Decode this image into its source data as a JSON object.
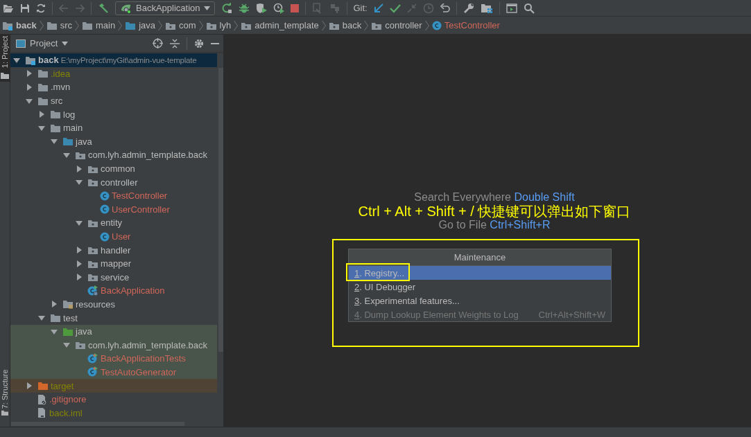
{
  "toolbar": {
    "run_config": "BackApplication",
    "git_label": "Git:"
  },
  "breadcrumbs": [
    {
      "label": "back",
      "kind": "module"
    },
    {
      "label": "src",
      "kind": "folder"
    },
    {
      "label": "main",
      "kind": "folder"
    },
    {
      "label": "java",
      "kind": "source-root"
    },
    {
      "label": "com",
      "kind": "package"
    },
    {
      "label": "lyh",
      "kind": "package"
    },
    {
      "label": "admin_template",
      "kind": "package"
    },
    {
      "label": "back",
      "kind": "package"
    },
    {
      "label": "controller",
      "kind": "package"
    },
    {
      "label": "TestController",
      "kind": "class"
    }
  ],
  "side_tabs": [
    {
      "label": "1: Project",
      "selected": true
    },
    {
      "label": "7: Structure",
      "selected": false
    }
  ],
  "project_panel": {
    "title": "Project",
    "tree": [
      {
        "label": "back",
        "path": "E:\\myProject\\myGit\\admin-vue-template",
        "kind": "module",
        "color": "#bbbbbb",
        "in_test": false,
        "excluded": false,
        "selected": true,
        "expanded": true,
        "children": [
          {
            "label": ".idea",
            "kind": "folder",
            "color": "#848504",
            "in_test": false,
            "excluded": false,
            "selected": false,
            "expanded": false
          },
          {
            "label": ".mvn",
            "kind": "folder",
            "color": "#bbbbbb",
            "in_test": false,
            "excluded": false,
            "selected": false,
            "expanded": false
          },
          {
            "label": "src",
            "kind": "folder",
            "color": "#bbbbbb",
            "in_test": false,
            "excluded": false,
            "selected": false,
            "expanded": true,
            "children": [
              {
                "label": "log",
                "kind": "folder",
                "color": "#bbbbbb",
                "in_test": false,
                "excluded": false,
                "selected": false,
                "expanded": false
              },
              {
                "label": "main",
                "kind": "folder",
                "color": "#bbbbbb",
                "in_test": false,
                "excluded": false,
                "selected": false,
                "expanded": true,
                "children": [
                  {
                    "label": "java",
                    "kind": "source-root",
                    "color": "#bbbbbb",
                    "in_test": false,
                    "excluded": false,
                    "selected": false,
                    "expanded": true,
                    "children": [
                      {
                        "label": "com.lyh.admin_template.back",
                        "kind": "package",
                        "color": "#bbbbbb",
                        "in_test": false,
                        "excluded": false,
                        "selected": false,
                        "expanded": true,
                        "children": [
                          {
                            "label": "common",
                            "kind": "package",
                            "color": "#bbbbbb",
                            "in_test": false,
                            "excluded": false,
                            "selected": false,
                            "expanded": false
                          },
                          {
                            "label": "controller",
                            "kind": "package",
                            "color": "#bbbbbb",
                            "in_test": false,
                            "excluded": false,
                            "selected": false,
                            "expanded": true,
                            "children": [
                              {
                                "label": "TestController",
                                "kind": "class",
                                "color": "#d1675a",
                                "in_test": false,
                                "excluded": false,
                                "selected": false
                              },
                              {
                                "label": "UserController",
                                "kind": "class",
                                "color": "#d1675a",
                                "in_test": false,
                                "excluded": false,
                                "selected": false
                              }
                            ]
                          },
                          {
                            "label": "entity",
                            "kind": "package",
                            "color": "#bbbbbb",
                            "in_test": false,
                            "excluded": false,
                            "selected": false,
                            "expanded": true,
                            "children": [
                              {
                                "label": "User",
                                "kind": "class",
                                "color": "#d1675a",
                                "in_test": false,
                                "excluded": false,
                                "selected": false
                              }
                            ]
                          },
                          {
                            "label": "handler",
                            "kind": "package",
                            "color": "#bbbbbb",
                            "in_test": false,
                            "excluded": false,
                            "selected": false,
                            "expanded": false
                          },
                          {
                            "label": "mapper",
                            "kind": "package",
                            "color": "#bbbbbb",
                            "in_test": false,
                            "excluded": false,
                            "selected": false,
                            "expanded": false
                          },
                          {
                            "label": "service",
                            "kind": "package",
                            "color": "#bbbbbb",
                            "in_test": false,
                            "excluded": false,
                            "selected": false,
                            "expanded": false
                          },
                          {
                            "label": "BackApplication",
                            "kind": "spring-app",
                            "color": "#d1675a",
                            "in_test": false,
                            "excluded": false,
                            "selected": false
                          }
                        ]
                      }
                    ]
                  },
                  {
                    "label": "resources",
                    "kind": "resources",
                    "color": "#bbbbbb",
                    "in_test": false,
                    "excluded": false,
                    "selected": false,
                    "expanded": false
                  }
                ]
              },
              {
                "label": "test",
                "kind": "folder",
                "color": "#bbbbbb",
                "in_test": false,
                "excluded": false,
                "selected": false,
                "expanded": true,
                "children": [
                  {
                    "label": "java",
                    "kind": "test-root",
                    "color": "#bbbbbb",
                    "in_test": true,
                    "excluded": false,
                    "selected": false,
                    "expanded": true,
                    "children": [
                      {
                        "label": "com.lyh.admin_template.back",
                        "kind": "package",
                        "color": "#bbbbbb",
                        "in_test": true,
                        "excluded": false,
                        "selected": false,
                        "expanded": true,
                        "children": [
                          {
                            "label": "BackApplicationTests",
                            "kind": "test-class",
                            "color": "#d1675a",
                            "in_test": true,
                            "excluded": false,
                            "selected": false
                          },
                          {
                            "label": "TestAutoGenerator",
                            "kind": "test-class",
                            "color": "#d1675a",
                            "in_test": true,
                            "excluded": false,
                            "selected": false
                          }
                        ]
                      }
                    ]
                  }
                ]
              }
            ]
          },
          {
            "label": "target",
            "kind": "excluded",
            "color": "#848504",
            "in_test": false,
            "excluded": true,
            "selected": false,
            "expanded": false
          },
          {
            "label": ".gitignore",
            "kind": "ignore-file",
            "color": "#d1675a",
            "in_test": false,
            "excluded": false,
            "selected": false
          },
          {
            "label": "back.iml",
            "kind": "iml-file",
            "color": "#848504",
            "in_test": false,
            "excluded": false,
            "selected": false
          }
        ]
      }
    ]
  },
  "editor_hints": [
    {
      "action": "Search Everywhere",
      "shortcut": "Double Shift"
    },
    {
      "action": "Go to File",
      "shortcut": "Ctrl+Shift+R"
    }
  ],
  "annotation": "Ctrl + Alt + Shift + / 快捷键可以弹出如下窗口",
  "popup": {
    "title": "Maintenance",
    "items": [
      {
        "label": "1. Registry...",
        "selected": true,
        "disabled": false,
        "highlighted": true
      },
      {
        "label": "2. UI Debugger",
        "selected": false,
        "disabled": false,
        "highlighted": false
      },
      {
        "label": "3. Experimental features...",
        "selected": false,
        "disabled": false,
        "highlighted": false
      },
      {
        "label": "4. Dump Lookup Element Weights to Log",
        "shortcut": "Ctrl+Alt+Shift+W",
        "selected": false,
        "disabled": true,
        "highlighted": false
      }
    ]
  }
}
